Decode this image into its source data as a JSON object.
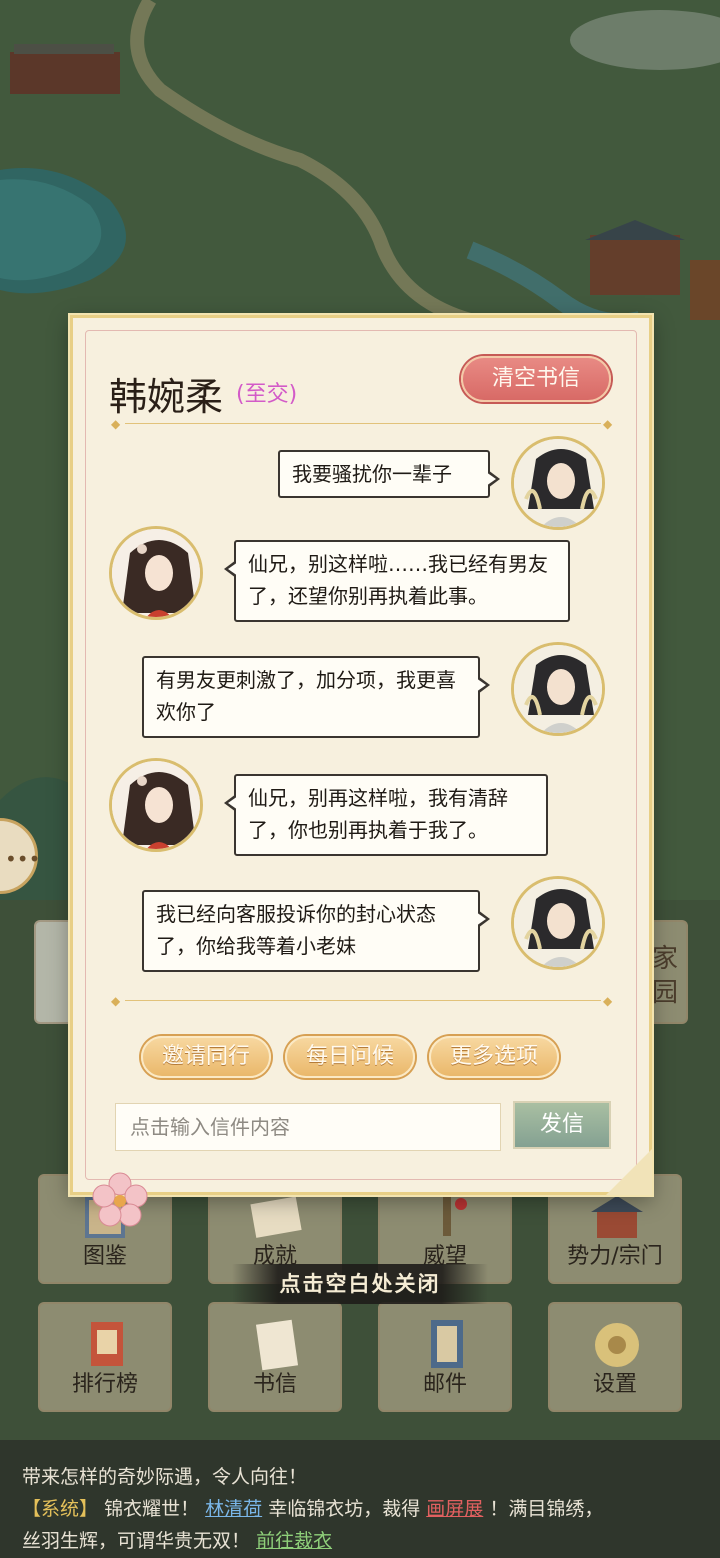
{
  "dialog": {
    "contact_name": "韩婉柔",
    "relation": "(至交)",
    "clear_button": "清空书信",
    "messages": [
      {
        "side": "right",
        "text": "我要骚扰你一辈子"
      },
      {
        "side": "left",
        "text": "仙兄，别这样啦……我已经有男友了，还望你别再执着此事。"
      },
      {
        "side": "right",
        "text": "有男友更刺激了，加分项，我更喜欢你了"
      },
      {
        "side": "left",
        "text": "仙兄，别再这样啦，我有清辞了，你也别再执着于我了。"
      },
      {
        "side": "right",
        "text": "我已经向客服投诉你的封心状态了，你给我等着小老妹"
      }
    ],
    "actions": [
      "邀请同行",
      "每日问候",
      "更多选项"
    ],
    "input_placeholder": "点击输入信件内容",
    "send_button": "发信"
  },
  "close_hint": "点击空白处关闭",
  "menu": {
    "home_label": "家园",
    "row1": [
      "图鉴",
      "成就",
      "威望",
      "势力/宗门"
    ],
    "row2": [
      "排行榜",
      "书信",
      "邮件",
      "设置"
    ]
  },
  "feed": {
    "line1": "带来怎样的奇妙际遇，令人向往！",
    "system_tag": "【系统】",
    "line2_a": "锦衣耀世！",
    "line2_name": "林清荷",
    "line2_b": "幸临锦衣坊，裁得",
    "line2_item": "画屏展",
    "line2_c": "！满目锦绣，",
    "line3_a": "丝羽生辉，可谓华贵无双！",
    "line3_link": "前往裁衣"
  },
  "colors": {
    "relation": "#d35bc8",
    "clear_button": "#d86a66",
    "pill": "#eab86b",
    "send_button": "#84a192",
    "system_tag": "#e4c05a"
  }
}
